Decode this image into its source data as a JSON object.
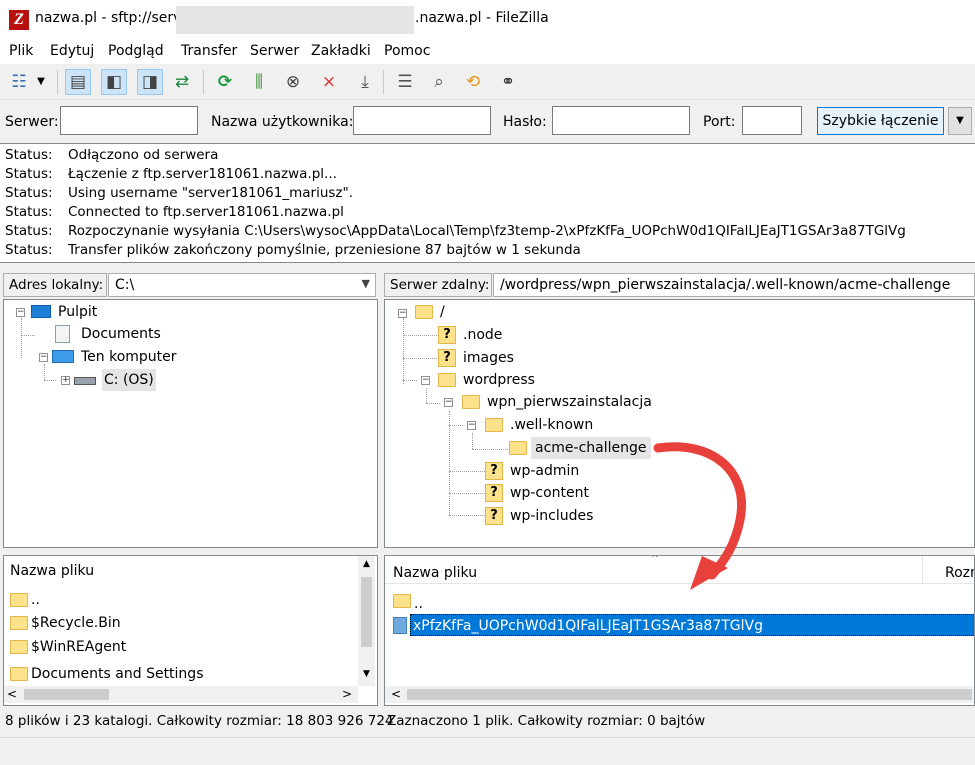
{
  "window": {
    "title_left": "nazwa.pl - sftp://serve",
    "title_right": ".nazwa.pl - FileZilla"
  },
  "menu": [
    "Plik",
    "Edytuj",
    "Podgląd",
    "Transfer",
    "Serwer",
    "Zakładki",
    "Pomoc"
  ],
  "toolbar_icons": [
    "site-manager-icon",
    "dropdown-arrow-icon",
    "toggle-log-icon",
    "toggle-local-tree-icon",
    "toggle-remote-tree-icon",
    "toggle-queue-icon",
    "refresh-icon",
    "process-queue-icon",
    "cancel-icon",
    "disconnect-icon",
    "reconnect-icon",
    "directory-listing-filters-icon",
    "compare-icon",
    "sync-browsing-icon",
    "search-remote-icon"
  ],
  "quickconnect": {
    "server_label": "Serwer:",
    "user_label": "Nazwa użytkownika:",
    "password_label": "Hasło:",
    "port_label": "Port:",
    "connect_button": "Szybkie łączenie"
  },
  "log": [
    {
      "label": "Status:",
      "message": "Odłączono od serwera"
    },
    {
      "label": "Status:",
      "message": "Łączenie z ftp.server181061.nazwa.pl..."
    },
    {
      "label": "Status:",
      "message": "Using username \"server181061_mariusz\"."
    },
    {
      "label": "Status:",
      "message": "Connected to ftp.server181061.nazwa.pl"
    },
    {
      "label": "Status:",
      "message": "Rozpoczynanie wysyłania C:\\Users\\wysoc\\AppData\\Local\\Temp\\fz3temp-2\\xPfzKfFa_UOPchW0d1QIFalLJEaJT1GSAr3a87TGlVg"
    },
    {
      "label": "Status:",
      "message": "Transfer plików zakończony pomyślnie, przeniesione 87 bajtów w 1 sekunda"
    }
  ],
  "local": {
    "address_label": "Adres lokalny:",
    "address_value": "C:\\",
    "tree": [
      "Pulpit",
      "Documents",
      "Ten komputer",
      "C: (OS)"
    ],
    "list_header": "Nazwa pliku",
    "files": [
      "..",
      "$Recycle.Bin",
      "$WinREAgent",
      "Documents and Settings"
    ],
    "status": "8 plików i 23 katalogi. Całkowity rozmiar: 18 803 926 724"
  },
  "remote": {
    "address_label": "Serwer zdalny:",
    "address_value": "/wordpress/wpn_pierwszainstalacja/.well-known/acme-challenge",
    "tree": [
      "/",
      ".node",
      "images",
      "wordpress",
      "wpn_pierwszainstalacja",
      ".well-known",
      "acme-challenge",
      "wp-admin",
      "wp-content",
      "wp-includes"
    ],
    "list_header": "Nazwa pliku",
    "list_header_size": "Rozm",
    "files": [
      "..",
      "xPfzKfFa_UOPchW0d1QIFalLJEaJT1GSAr3a87TGlVg"
    ],
    "status": "Zaznaczono 1 plik. Całkowity rozmiar: 0 bajtów"
  },
  "colors": {
    "selection": "#0078d7",
    "arrow": "#e8403a",
    "folder": "#fce28a"
  }
}
